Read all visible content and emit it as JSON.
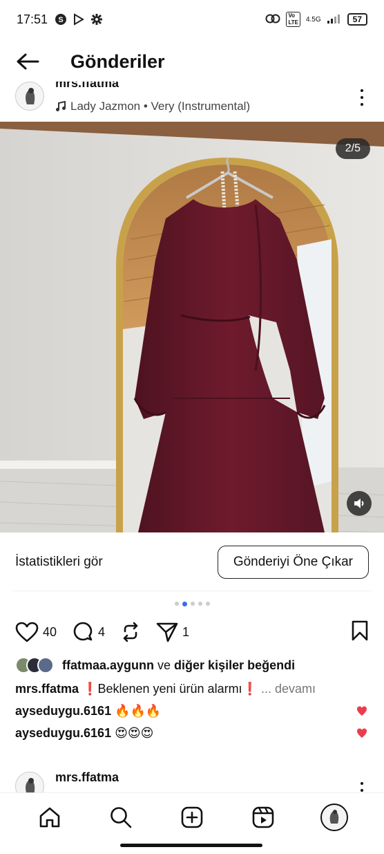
{
  "status_bar": {
    "time": "17:51",
    "network": "4.5G",
    "battery": "57"
  },
  "header": {
    "title": "Gönderiler"
  },
  "post": {
    "username": "mrs.ffatma",
    "music": "Lady Jazmon • Very (Instrumental)",
    "media_counter": "2/5",
    "stats_label": "İstatistikleri gör",
    "boost_label": "Gönderiyi Öne Çıkar",
    "likes_count": "40",
    "comments_count": "4",
    "reposts_count": "",
    "shares_count": "1",
    "liked_by_user": "ffatmaa.aygunn",
    "liked_by_rest": " ve ",
    "liked_by_others": "diğer kişiler beğendi",
    "caption_user": "mrs.ffatma",
    "caption_text": " ❗Beklenen yeni ürün alarmı❗ ",
    "caption_more": "... devamı",
    "comments": [
      {
        "user": "ayseduygu.6161",
        "text": " 🔥🔥🔥"
      },
      {
        "user": "ayseduygu.6161",
        "text": " 😍😍😍"
      }
    ],
    "carousel_total": 5,
    "carousel_active": 1
  },
  "next_post": {
    "username": "mrs.ffatma"
  },
  "colors": {
    "accent_blue": "#3a6cf0",
    "like_red": "#ed3b4f",
    "dress": "#6b1b2a",
    "mirror_gold": "#c8a24a"
  },
  "icons": [
    "back-arrow-icon",
    "heart-icon",
    "comment-icon",
    "repost-icon",
    "share-icon",
    "bookmark-icon",
    "home-icon",
    "search-icon",
    "create-icon",
    "reels-icon",
    "music-icon",
    "mute-icon",
    "more-icon"
  ]
}
